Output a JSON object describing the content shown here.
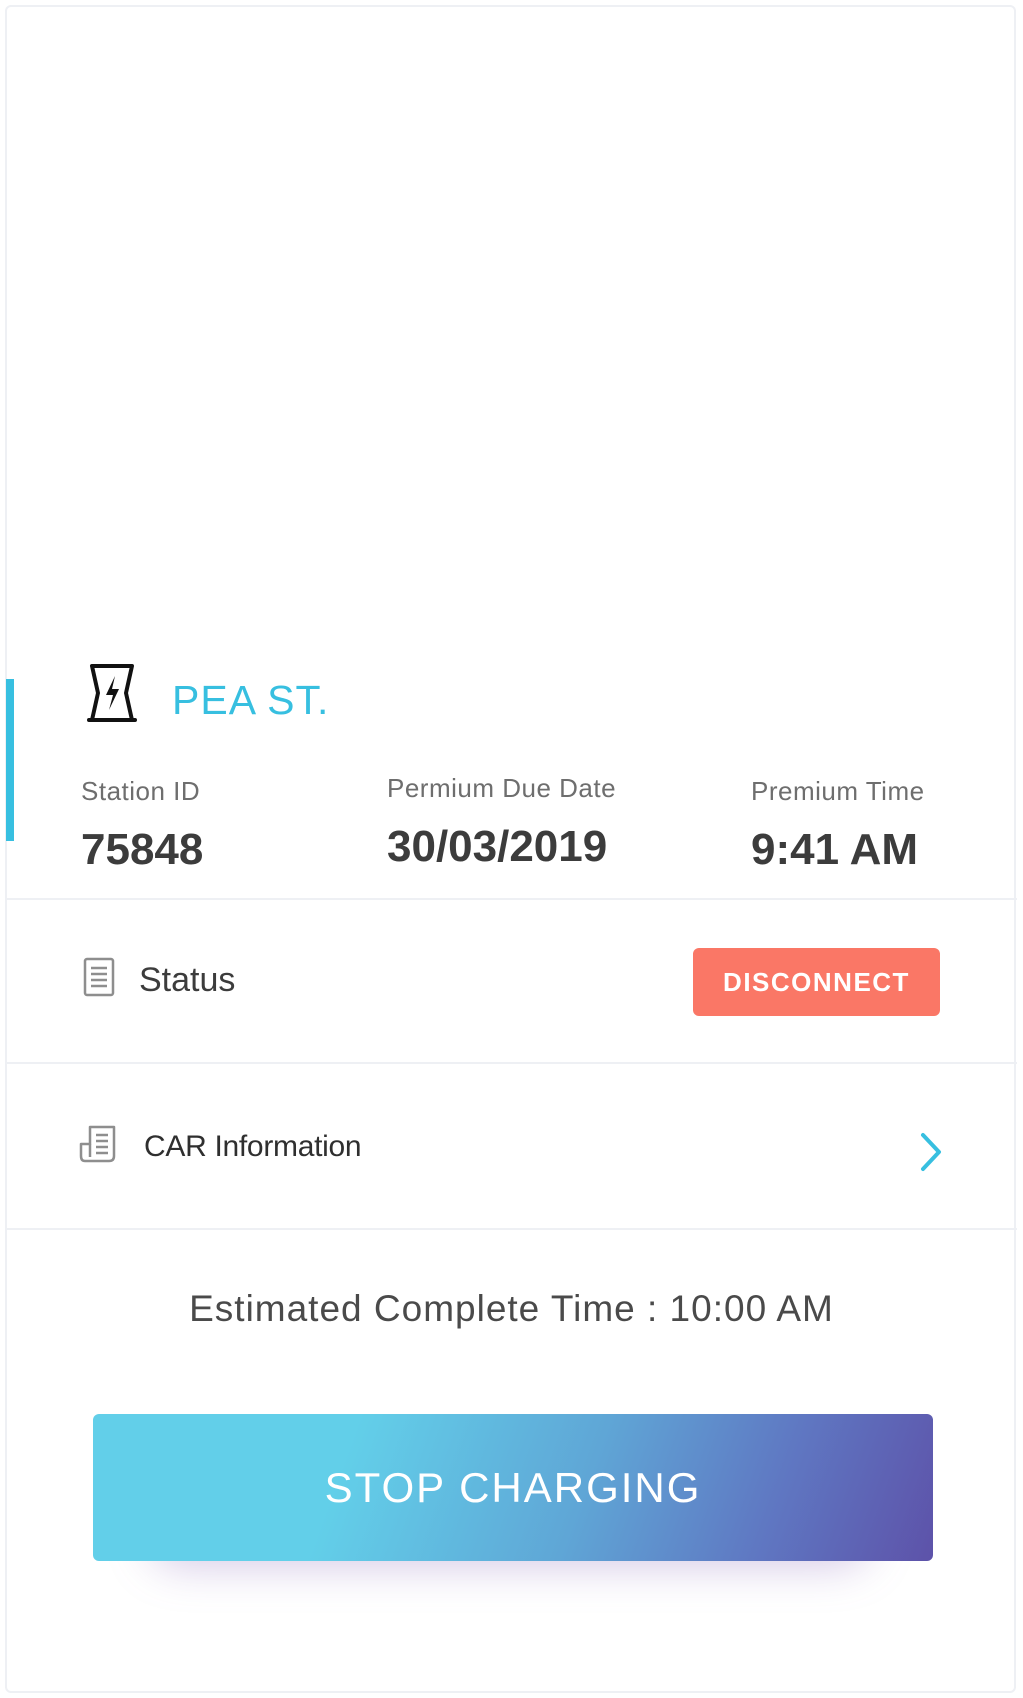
{
  "station": {
    "name": "PEA ST.",
    "icon": "charging-station-icon"
  },
  "info": {
    "station_id_label": "Station ID",
    "station_id_value": "75848",
    "due_date_label": "Permium Due Date",
    "due_date_value": "30/03/2019",
    "premium_time_label": "Premium Time",
    "premium_time_value": "9:41 AM"
  },
  "status": {
    "label": "Status",
    "icon": "document-icon",
    "button_label": "DISCONNECT",
    "button_color": "#fa7766"
  },
  "car_info": {
    "label": "CAR Information",
    "icon": "receipt-icon",
    "chevron_icon": "chevron-right-icon"
  },
  "eta": {
    "text": "Estimated Complete Time : 10:00 AM"
  },
  "action": {
    "stop_label": "STOP CHARGING"
  },
  "colors": {
    "accent": "#37bfe0",
    "danger": "#fa7766",
    "gradient_start": "#62cfe9",
    "gradient_end": "#5d52a9"
  }
}
